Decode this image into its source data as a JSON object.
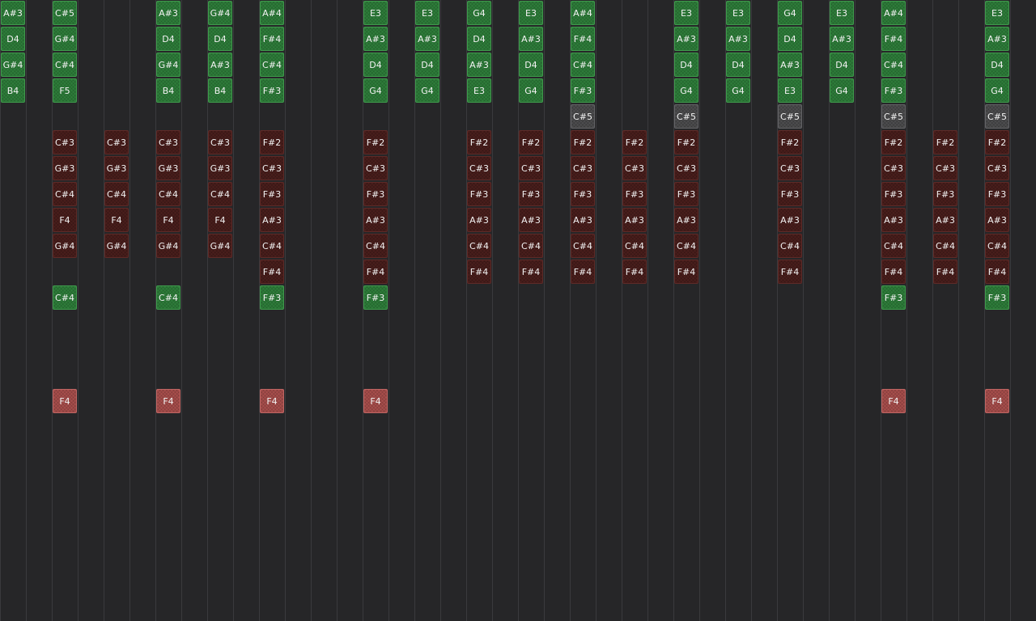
{
  "colors": {
    "background": "#262628",
    "grid_line": "#3a3a3d",
    "green": "#2e7d3a",
    "dark": "#4a1e1c",
    "pink": "#a84e4c",
    "gray": "#4d4d4f"
  },
  "columns": [
    {
      "notes": [
        {
          "row": 0,
          "label": "A#3",
          "kind": "green"
        },
        {
          "row": 1,
          "label": "D4",
          "kind": "green"
        },
        {
          "row": 2,
          "label": "G#4",
          "kind": "green"
        },
        {
          "row": 3,
          "label": "B4",
          "kind": "green"
        }
      ]
    },
    {
      "notes": []
    },
    {
      "notes": [
        {
          "row": 0,
          "label": "C#5",
          "kind": "green"
        },
        {
          "row": 1,
          "label": "G#4",
          "kind": "green"
        },
        {
          "row": 2,
          "label": "C#4",
          "kind": "green"
        },
        {
          "row": 3,
          "label": "F5",
          "kind": "green"
        },
        {
          "row": 5,
          "label": "C#3",
          "kind": "dark"
        },
        {
          "row": 6,
          "label": "G#3",
          "kind": "dark"
        },
        {
          "row": 7,
          "label": "C#4",
          "kind": "dark"
        },
        {
          "row": 8,
          "label": "F4",
          "kind": "dark"
        },
        {
          "row": 9,
          "label": "G#4",
          "kind": "dark"
        },
        {
          "row": 11,
          "label": "C#4",
          "kind": "green"
        },
        {
          "row": 15,
          "label": "F4",
          "kind": "pink"
        }
      ]
    },
    {
      "notes": []
    },
    {
      "notes": [
        {
          "row": 5,
          "label": "C#3",
          "kind": "dark"
        },
        {
          "row": 6,
          "label": "G#3",
          "kind": "dark"
        },
        {
          "row": 7,
          "label": "C#4",
          "kind": "dark"
        },
        {
          "row": 8,
          "label": "F4",
          "kind": "dark"
        },
        {
          "row": 9,
          "label": "G#4",
          "kind": "dark"
        }
      ]
    },
    {
      "notes": []
    },
    {
      "notes": [
        {
          "row": 0,
          "label": "A#3",
          "kind": "green"
        },
        {
          "row": 1,
          "label": "D4",
          "kind": "green"
        },
        {
          "row": 2,
          "label": "G#4",
          "kind": "green"
        },
        {
          "row": 3,
          "label": "B4",
          "kind": "green"
        },
        {
          "row": 5,
          "label": "C#3",
          "kind": "dark"
        },
        {
          "row": 6,
          "label": "G#3",
          "kind": "dark"
        },
        {
          "row": 7,
          "label": "C#4",
          "kind": "dark"
        },
        {
          "row": 8,
          "label": "F4",
          "kind": "dark"
        },
        {
          "row": 9,
          "label": "G#4",
          "kind": "dark"
        },
        {
          "row": 11,
          "label": "C#4",
          "kind": "green"
        },
        {
          "row": 15,
          "label": "F4",
          "kind": "pink"
        }
      ]
    },
    {
      "notes": []
    },
    {
      "notes": [
        {
          "row": 0,
          "label": "G#4",
          "kind": "green"
        },
        {
          "row": 1,
          "label": "D4",
          "kind": "green"
        },
        {
          "row": 2,
          "label": "A#3",
          "kind": "green"
        },
        {
          "row": 3,
          "label": "B4",
          "kind": "green"
        },
        {
          "row": 5,
          "label": "C#3",
          "kind": "dark"
        },
        {
          "row": 6,
          "label": "G#3",
          "kind": "dark"
        },
        {
          "row": 7,
          "label": "C#4",
          "kind": "dark"
        },
        {
          "row": 8,
          "label": "F4",
          "kind": "dark"
        },
        {
          "row": 9,
          "label": "G#4",
          "kind": "dark"
        }
      ]
    },
    {
      "notes": []
    },
    {
      "notes": [
        {
          "row": 0,
          "label": "A#4",
          "kind": "green"
        },
        {
          "row": 1,
          "label": "F#4",
          "kind": "green"
        },
        {
          "row": 2,
          "label": "C#4",
          "kind": "green"
        },
        {
          "row": 3,
          "label": "F#3",
          "kind": "green"
        },
        {
          "row": 5,
          "label": "F#2",
          "kind": "dark"
        },
        {
          "row": 6,
          "label": "C#3",
          "kind": "dark"
        },
        {
          "row": 7,
          "label": "F#3",
          "kind": "dark"
        },
        {
          "row": 8,
          "label": "A#3",
          "kind": "dark"
        },
        {
          "row": 9,
          "label": "C#4",
          "kind": "dark"
        },
        {
          "row": 10,
          "label": "F#4",
          "kind": "dark"
        },
        {
          "row": 11,
          "label": "F#3",
          "kind": "green"
        },
        {
          "row": 15,
          "label": "F4",
          "kind": "pink"
        }
      ]
    },
    {
      "notes": []
    },
    {
      "notes": []
    },
    {
      "notes": []
    },
    {
      "notes": [
        {
          "row": 0,
          "label": "E3",
          "kind": "green"
        },
        {
          "row": 1,
          "label": "A#3",
          "kind": "green"
        },
        {
          "row": 2,
          "label": "D4",
          "kind": "green"
        },
        {
          "row": 3,
          "label": "G4",
          "kind": "green"
        },
        {
          "row": 5,
          "label": "F#2",
          "kind": "dark"
        },
        {
          "row": 6,
          "label": "C#3",
          "kind": "dark"
        },
        {
          "row": 7,
          "label": "F#3",
          "kind": "dark"
        },
        {
          "row": 8,
          "label": "A#3",
          "kind": "dark"
        },
        {
          "row": 9,
          "label": "C#4",
          "kind": "dark"
        },
        {
          "row": 10,
          "label": "F#4",
          "kind": "dark"
        },
        {
          "row": 11,
          "label": "F#3",
          "kind": "green"
        },
        {
          "row": 15,
          "label": "F4",
          "kind": "pink"
        }
      ]
    },
    {
      "notes": []
    },
    {
      "notes": [
        {
          "row": 0,
          "label": "E3",
          "kind": "green"
        },
        {
          "row": 1,
          "label": "A#3",
          "kind": "green"
        },
        {
          "row": 2,
          "label": "D4",
          "kind": "green"
        },
        {
          "row": 3,
          "label": "G4",
          "kind": "green"
        }
      ]
    },
    {
      "notes": []
    },
    {
      "notes": [
        {
          "row": 0,
          "label": "G4",
          "kind": "green"
        },
        {
          "row": 1,
          "label": "D4",
          "kind": "green"
        },
        {
          "row": 2,
          "label": "A#3",
          "kind": "green"
        },
        {
          "row": 3,
          "label": "E3",
          "kind": "green"
        },
        {
          "row": 5,
          "label": "F#2",
          "kind": "dark"
        },
        {
          "row": 6,
          "label": "C#3",
          "kind": "dark"
        },
        {
          "row": 7,
          "label": "F#3",
          "kind": "dark"
        },
        {
          "row": 8,
          "label": "A#3",
          "kind": "dark"
        },
        {
          "row": 9,
          "label": "C#4",
          "kind": "dark"
        },
        {
          "row": 10,
          "label": "F#4",
          "kind": "dark"
        }
      ]
    },
    {
      "notes": []
    },
    {
      "notes": [
        {
          "row": 0,
          "label": "E3",
          "kind": "green"
        },
        {
          "row": 1,
          "label": "A#3",
          "kind": "green"
        },
        {
          "row": 2,
          "label": "D4",
          "kind": "green"
        },
        {
          "row": 3,
          "label": "G4",
          "kind": "green"
        },
        {
          "row": 5,
          "label": "F#2",
          "kind": "dark"
        },
        {
          "row": 6,
          "label": "C#3",
          "kind": "dark"
        },
        {
          "row": 7,
          "label": "F#3",
          "kind": "dark"
        },
        {
          "row": 8,
          "label": "A#3",
          "kind": "dark"
        },
        {
          "row": 9,
          "label": "C#4",
          "kind": "dark"
        },
        {
          "row": 10,
          "label": "F#4",
          "kind": "dark"
        }
      ]
    },
    {
      "notes": []
    },
    {
      "notes": [
        {
          "row": 0,
          "label": "A#4",
          "kind": "green"
        },
        {
          "row": 1,
          "label": "F#4",
          "kind": "green"
        },
        {
          "row": 2,
          "label": "C#4",
          "kind": "green"
        },
        {
          "row": 3,
          "label": "F#3",
          "kind": "green"
        },
        {
          "row": 4,
          "label": "C#5",
          "kind": "gray"
        },
        {
          "row": 5,
          "label": "F#2",
          "kind": "dark"
        },
        {
          "row": 6,
          "label": "C#3",
          "kind": "dark"
        },
        {
          "row": 7,
          "label": "F#3",
          "kind": "dark"
        },
        {
          "row": 8,
          "label": "A#3",
          "kind": "dark"
        },
        {
          "row": 9,
          "label": "C#4",
          "kind": "dark"
        },
        {
          "row": 10,
          "label": "F#4",
          "kind": "dark"
        }
      ]
    },
    {
      "notes": []
    },
    {
      "notes": [
        {
          "row": 5,
          "label": "F#2",
          "kind": "dark"
        },
        {
          "row": 6,
          "label": "C#3",
          "kind": "dark"
        },
        {
          "row": 7,
          "label": "F#3",
          "kind": "dark"
        },
        {
          "row": 8,
          "label": "A#3",
          "kind": "dark"
        },
        {
          "row": 9,
          "label": "C#4",
          "kind": "dark"
        },
        {
          "row": 10,
          "label": "F#4",
          "kind": "dark"
        }
      ]
    },
    {
      "notes": []
    },
    {
      "notes": [
        {
          "row": 0,
          "label": "E3",
          "kind": "green"
        },
        {
          "row": 1,
          "label": "A#3",
          "kind": "green"
        },
        {
          "row": 2,
          "label": "D4",
          "kind": "green"
        },
        {
          "row": 3,
          "label": "G4",
          "kind": "green"
        },
        {
          "row": 4,
          "label": "C#5",
          "kind": "gray"
        },
        {
          "row": 5,
          "label": "F#2",
          "kind": "dark"
        },
        {
          "row": 6,
          "label": "C#3",
          "kind": "dark"
        },
        {
          "row": 7,
          "label": "F#3",
          "kind": "dark"
        },
        {
          "row": 8,
          "label": "A#3",
          "kind": "dark"
        },
        {
          "row": 9,
          "label": "C#4",
          "kind": "dark"
        },
        {
          "row": 10,
          "label": "F#4",
          "kind": "dark"
        }
      ]
    },
    {
      "notes": []
    },
    {
      "notes": [
        {
          "row": 0,
          "label": "E3",
          "kind": "green"
        },
        {
          "row": 1,
          "label": "A#3",
          "kind": "green"
        },
        {
          "row": 2,
          "label": "D4",
          "kind": "green"
        },
        {
          "row": 3,
          "label": "G4",
          "kind": "green"
        }
      ]
    },
    {
      "notes": []
    },
    {
      "notes": [
        {
          "row": 0,
          "label": "G4",
          "kind": "green"
        },
        {
          "row": 1,
          "label": "D4",
          "kind": "green"
        },
        {
          "row": 2,
          "label": "A#3",
          "kind": "green"
        },
        {
          "row": 3,
          "label": "E3",
          "kind": "green"
        },
        {
          "row": 4,
          "label": "C#5",
          "kind": "gray"
        },
        {
          "row": 5,
          "label": "F#2",
          "kind": "dark"
        },
        {
          "row": 6,
          "label": "C#3",
          "kind": "dark"
        },
        {
          "row": 7,
          "label": "F#3",
          "kind": "dark"
        },
        {
          "row": 8,
          "label": "A#3",
          "kind": "dark"
        },
        {
          "row": 9,
          "label": "C#4",
          "kind": "dark"
        },
        {
          "row": 10,
          "label": "F#4",
          "kind": "dark"
        }
      ]
    },
    {
      "notes": []
    },
    {
      "notes": [
        {
          "row": 0,
          "label": "E3",
          "kind": "green"
        },
        {
          "row": 1,
          "label": "A#3",
          "kind": "green"
        },
        {
          "row": 2,
          "label": "D4",
          "kind": "green"
        },
        {
          "row": 3,
          "label": "G4",
          "kind": "green"
        }
      ]
    },
    {
      "notes": []
    },
    {
      "notes": [
        {
          "row": 0,
          "label": "A#4",
          "kind": "green"
        },
        {
          "row": 1,
          "label": "F#4",
          "kind": "green"
        },
        {
          "row": 2,
          "label": "C#4",
          "kind": "green"
        },
        {
          "row": 3,
          "label": "F#3",
          "kind": "green"
        },
        {
          "row": 4,
          "label": "C#5",
          "kind": "gray"
        },
        {
          "row": 5,
          "label": "F#2",
          "kind": "dark"
        },
        {
          "row": 6,
          "label": "C#3",
          "kind": "dark"
        },
        {
          "row": 7,
          "label": "F#3",
          "kind": "dark"
        },
        {
          "row": 8,
          "label": "A#3",
          "kind": "dark"
        },
        {
          "row": 9,
          "label": "C#4",
          "kind": "dark"
        },
        {
          "row": 10,
          "label": "F#4",
          "kind": "dark"
        },
        {
          "row": 11,
          "label": "F#3",
          "kind": "green"
        },
        {
          "row": 15,
          "label": "F4",
          "kind": "pink"
        }
      ]
    },
    {
      "notes": []
    },
    {
      "notes": [
        {
          "row": 5,
          "label": "F#2",
          "kind": "dark"
        },
        {
          "row": 6,
          "label": "C#3",
          "kind": "dark"
        },
        {
          "row": 7,
          "label": "F#3",
          "kind": "dark"
        },
        {
          "row": 8,
          "label": "A#3",
          "kind": "dark"
        },
        {
          "row": 9,
          "label": "C#4",
          "kind": "dark"
        },
        {
          "row": 10,
          "label": "F#4",
          "kind": "dark"
        }
      ]
    },
    {
      "notes": []
    },
    {
      "notes": [
        {
          "row": 0,
          "label": "E3",
          "kind": "green"
        },
        {
          "row": 1,
          "label": "A#3",
          "kind": "green"
        },
        {
          "row": 2,
          "label": "D4",
          "kind": "green"
        },
        {
          "row": 3,
          "label": "G4",
          "kind": "green"
        },
        {
          "row": 4,
          "label": "C#5",
          "kind": "gray"
        },
        {
          "row": 5,
          "label": "F#2",
          "kind": "dark"
        },
        {
          "row": 6,
          "label": "C#3",
          "kind": "dark"
        },
        {
          "row": 7,
          "label": "F#3",
          "kind": "dark"
        },
        {
          "row": 8,
          "label": "A#3",
          "kind": "dark"
        },
        {
          "row": 9,
          "label": "C#4",
          "kind": "dark"
        },
        {
          "row": 10,
          "label": "F#4",
          "kind": "dark"
        },
        {
          "row": 11,
          "label": "F#3",
          "kind": "green"
        },
        {
          "row": 15,
          "label": "F4",
          "kind": "pink"
        }
      ]
    },
    {
      "notes": []
    }
  ]
}
